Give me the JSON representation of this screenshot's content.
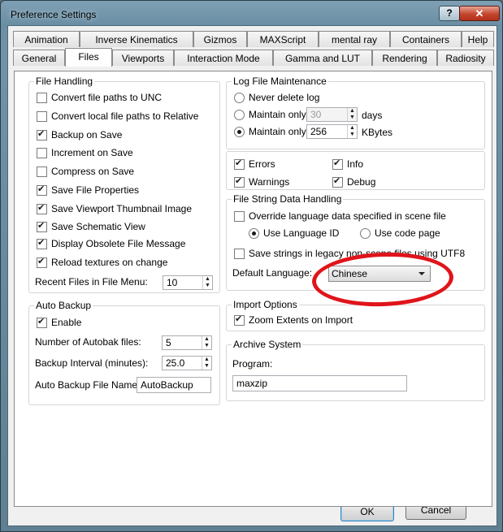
{
  "window": {
    "title": "Preference Settings",
    "help_label": "?",
    "close_label": "✕"
  },
  "tabs_row1": [
    "Animation",
    "Inverse Kinematics",
    "Gizmos",
    "MAXScript",
    "mental ray",
    "Containers",
    "Help"
  ],
  "tabs_row2": [
    "General",
    "Files",
    "Viewports",
    "Interaction Mode",
    "Gamma and LUT",
    "Rendering",
    "Radiosity"
  ],
  "active_tab": "Files",
  "file_handling": {
    "title": "File Handling",
    "options": [
      {
        "label": "Convert file paths to UNC",
        "checked": false
      },
      {
        "label": "Convert local file paths to Relative",
        "checked": false
      },
      {
        "label": "Backup on Save",
        "checked": true
      },
      {
        "label": "Increment on Save",
        "checked": false
      },
      {
        "label": "Compress on Save",
        "checked": false
      },
      {
        "label": "Save File Properties",
        "checked": true
      },
      {
        "label": "Save Viewport Thumbnail Image",
        "checked": true
      },
      {
        "label": "Save Schematic View",
        "checked": true
      },
      {
        "label": "Display Obsolete File Message",
        "checked": true
      },
      {
        "label": "Reload textures on change",
        "checked": true
      }
    ],
    "recent_files_label": "Recent Files in File Menu:",
    "recent_files_value": "10"
  },
  "auto_backup": {
    "title": "Auto Backup",
    "enable_label": "Enable",
    "enable_checked": true,
    "num_files_label": "Number of Autobak files:",
    "num_files_value": "5",
    "interval_label": "Backup Interval (minutes):",
    "interval_value": "25.0",
    "file_name_label": "Auto Backup File Name:",
    "file_name_value": "AutoBackup"
  },
  "log_file": {
    "title": "Log File Maintenance",
    "never_delete_label": "Never delete log",
    "maintain_days_label": "Maintain only",
    "maintain_days_value": "30",
    "days_unit": "days",
    "maintain_kb_label": "Maintain only",
    "maintain_kb_value": "256",
    "kb_unit": "KBytes",
    "selected": "kbytes",
    "errors_label": "Errors",
    "info_label": "Info",
    "warnings_label": "Warnings",
    "debug_label": "Debug"
  },
  "file_string": {
    "title": "File String Data Handling",
    "override_label": "Override language data specified in scene file",
    "use_language_id_label": "Use Language ID",
    "use_code_page_label": "Use code page",
    "save_strings_label": "Save strings in legacy non-scene files using UTF8",
    "default_language_label": "Default Language:",
    "default_language_value": "Chinese"
  },
  "import_options": {
    "title": "Import Options",
    "zoom_extents_label": "Zoom Extents on Import",
    "zoom_extents_checked": true
  },
  "archive": {
    "title": "Archive System",
    "program_label": "Program:",
    "program_value": "maxzip"
  },
  "buttons": {
    "ok": "OK",
    "cancel": "Cancel"
  },
  "colors": {
    "annotation": "#e0141a",
    "titlebar": "#7fa0b4"
  }
}
